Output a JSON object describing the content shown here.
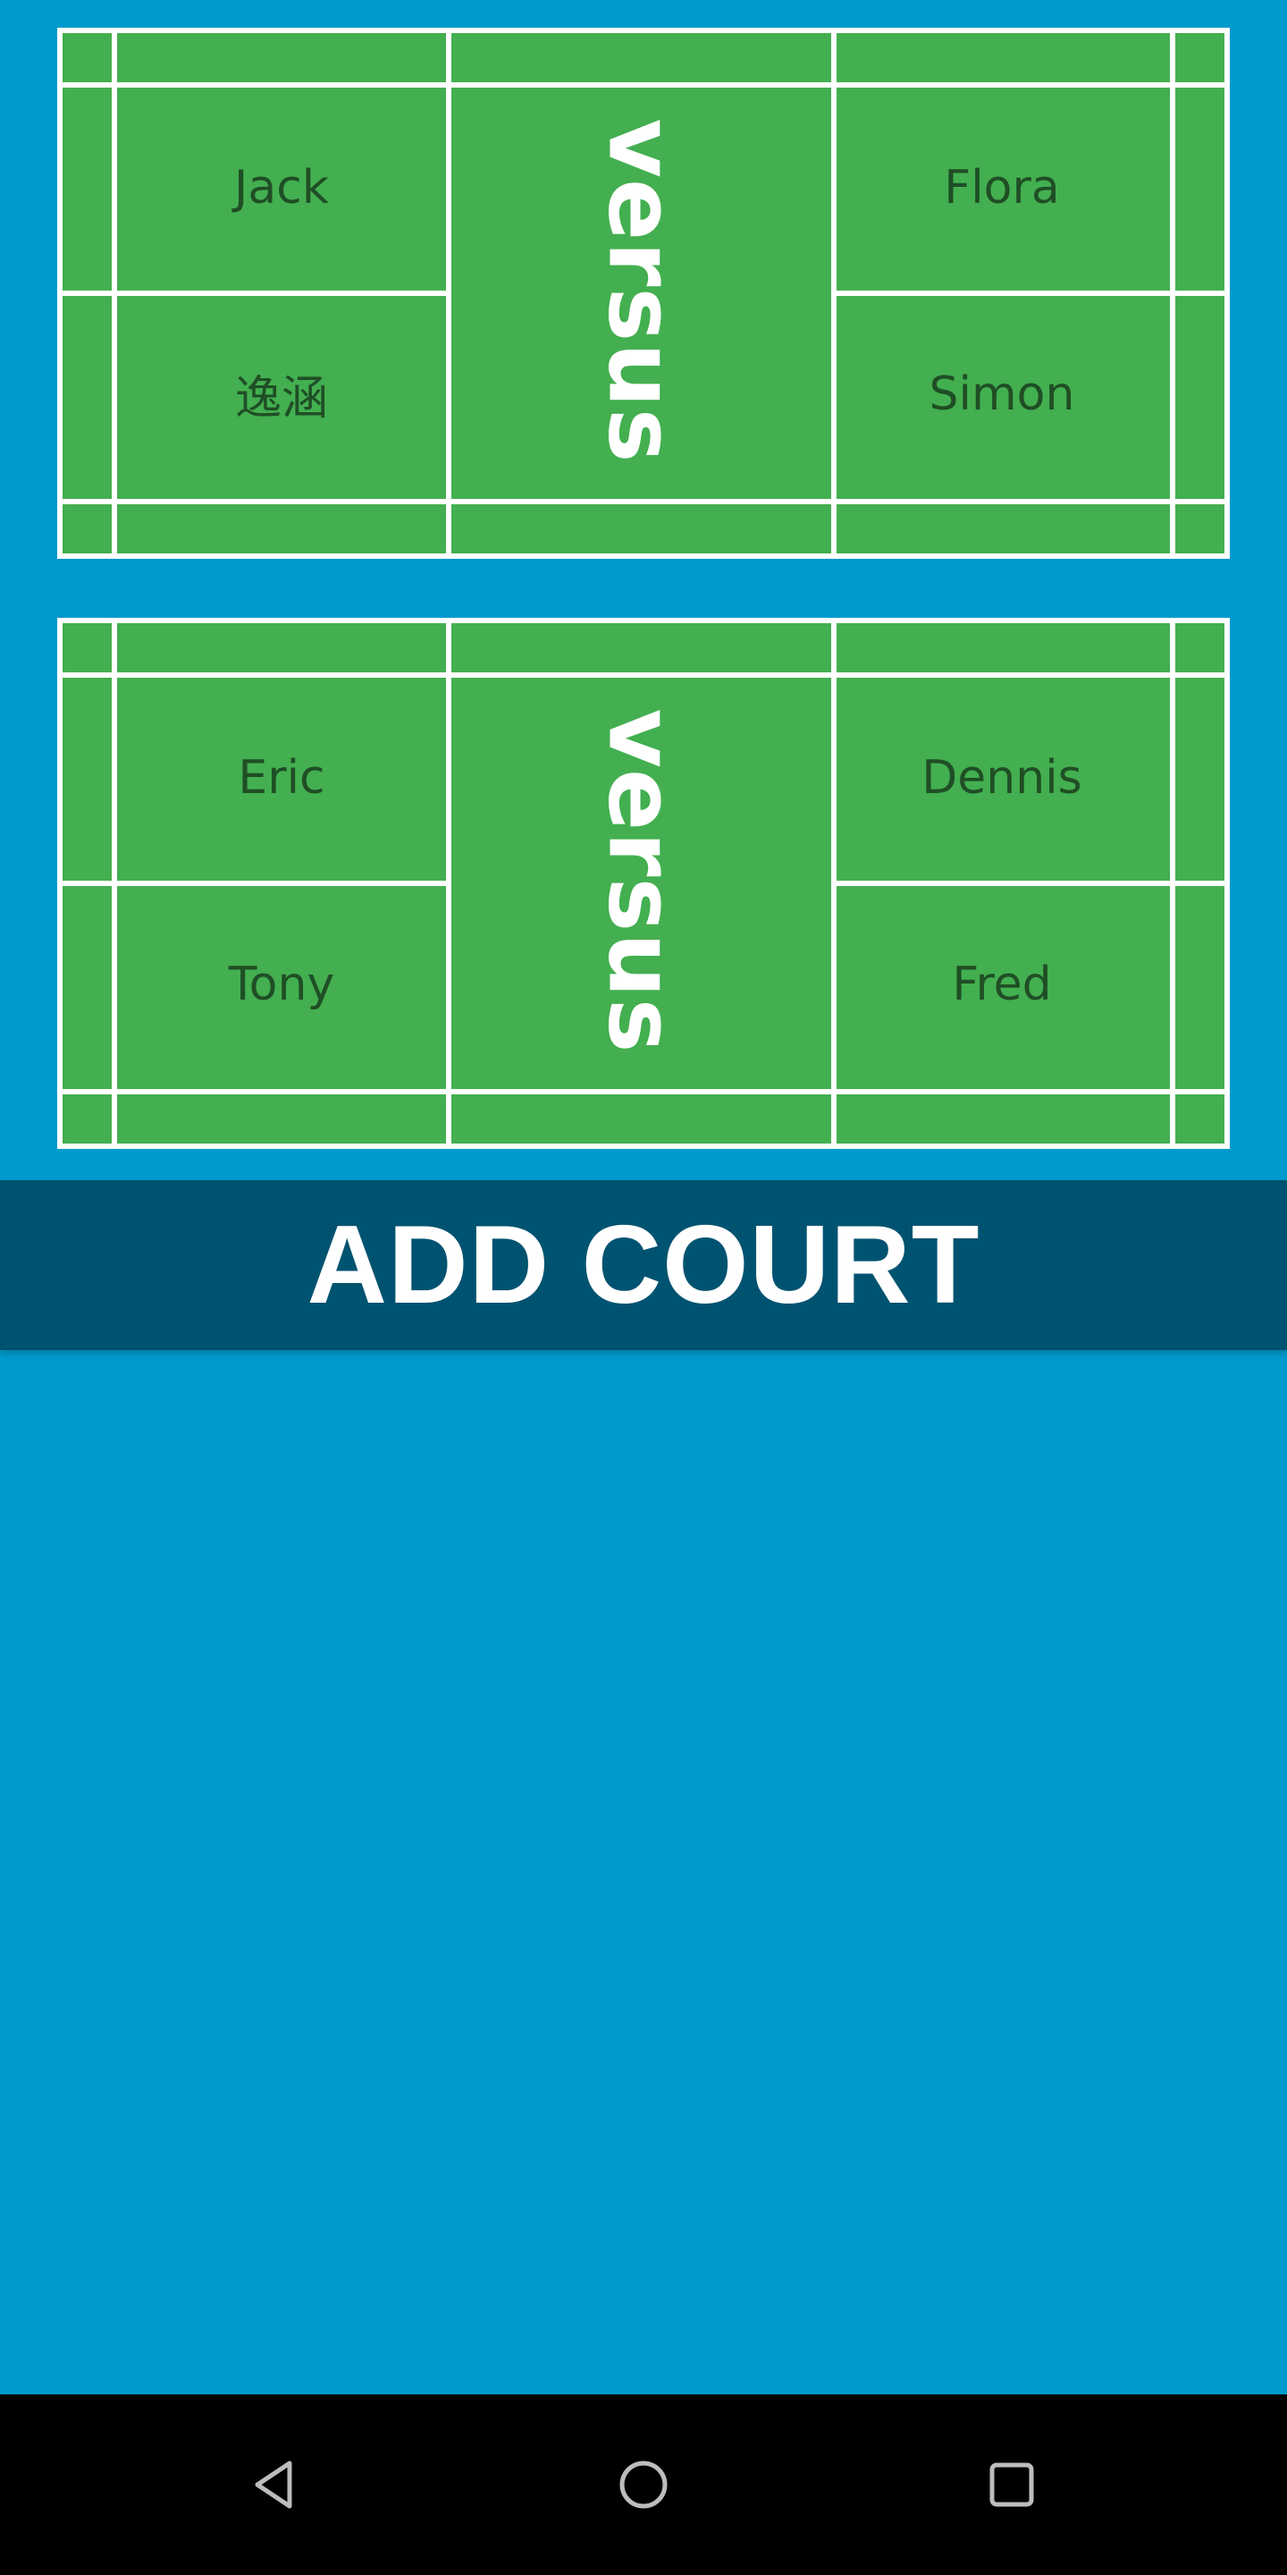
{
  "courts": [
    {
      "left_team": {
        "top": "Jack",
        "bottom": "逸涵"
      },
      "versus_label": "versus",
      "right_team": {
        "top": "Flora",
        "bottom": "Simon"
      }
    },
    {
      "left_team": {
        "top": "Eric",
        "bottom": "Tony"
      },
      "versus_label": "versus",
      "right_team": {
        "top": "Dennis",
        "bottom": "Fred"
      }
    }
  ],
  "add_court_button": {
    "label": "ADD COURT"
  },
  "nav_bar": {
    "buttons": [
      "back-icon",
      "home-icon",
      "recents-icon"
    ]
  },
  "colors": {
    "background": "#009ACD",
    "court_green": "#43AF50",
    "court_lines": "#FFFFFF",
    "player_text": "#1F4E25",
    "button_bg": "#005370",
    "button_text": "#FFFFFF",
    "nav_bar": "#000000"
  }
}
